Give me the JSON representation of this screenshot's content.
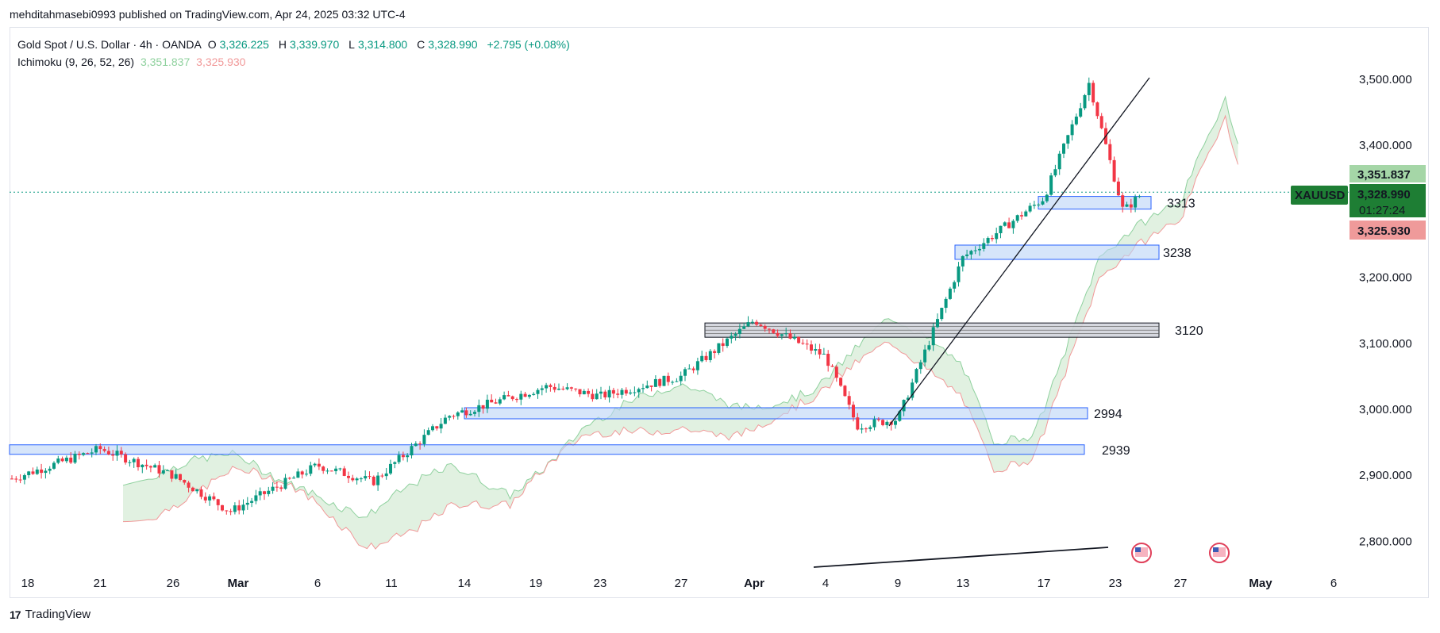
{
  "header": {
    "published_by": "mehditahmasebi0993 published on TradingView.com, Apr 24, 2025 03:32 UTC-4"
  },
  "legend": {
    "symbol_name": "Gold Spot / U.S. Dollar · 4h · OANDA",
    "o_label": "O",
    "o_value": "3,326.225",
    "h_label": "H",
    "h_value": "3,339.970",
    "l_label": "L",
    "l_value": "3,314.800",
    "c_label": "C",
    "c_value": "3,328.990",
    "change": "+2.795 (+0.08%)",
    "indicator_name": "Ichimoku (9, 26, 52, 26)",
    "indicator_val_a": "3,351.837",
    "indicator_val_b": "3,325.930"
  },
  "price_scale": {
    "ticks": [
      "3,500.000",
      "3,400.000",
      "3,200.000",
      "3,100.000",
      "3,000.000",
      "2,900.000",
      "2,800.000"
    ],
    "tick_values": [
      3500,
      3400,
      3200,
      3100,
      3000,
      2900,
      2800
    ],
    "symbol_tag": "XAUUSD",
    "last_price": "3,328.990",
    "countdown": "01:27:24",
    "ichimoku_a_tag": "3,351.837",
    "ichimoku_b_tag": "3,325.930"
  },
  "time_scale": {
    "labels": [
      "18",
      "21",
      "26",
      "Mar",
      "6",
      "11",
      "14",
      "19",
      "23",
      "27",
      "Apr",
      "4",
      "9",
      "13",
      "17",
      "23",
      "27",
      "May",
      "6"
    ],
    "bold": [
      "Mar",
      "Apr",
      "May"
    ]
  },
  "zones": [
    {
      "label": "3313",
      "level": 3313,
      "color": "blue"
    },
    {
      "label": "3238",
      "level": 3238,
      "color": "blue"
    },
    {
      "label": "3120",
      "level": 3120,
      "color": "gray"
    },
    {
      "label": "2994",
      "level": 2994,
      "color": "blue"
    },
    {
      "label": "2939",
      "level": 2939,
      "color": "blue"
    }
  ],
  "footer": {
    "brand": "TradingView",
    "logo_text": "17"
  },
  "colors": {
    "up": "#089981",
    "down": "#f23645",
    "cloud_green": "#c8e6c9",
    "cloud_red": "#f8cccc",
    "zone_blue": "#bbd3f7",
    "zone_blue_border": "#2962ff",
    "zone_gray": "#b0b0b0",
    "tag_green": "#1e7e34",
    "tag_a": "#a5d6a7",
    "tag_b": "#ef9a9a"
  },
  "chart_data": {
    "type": "candlestick",
    "title": "Gold Spot / U.S. Dollar · 4h · OANDA",
    "ylim": [
      2760,
      3520
    ],
    "x_ticks": [
      "18",
      "21",
      "26",
      "Mar",
      "6",
      "11",
      "14",
      "19",
      "23",
      "27",
      "Apr",
      "4",
      "9",
      "13",
      "17",
      "23",
      "27",
      "May",
      "6"
    ],
    "key_path": [
      {
        "t": "18",
        "price": 2895
      },
      {
        "t": "21",
        "price": 2940
      },
      {
        "t": "26",
        "price": 2900
      },
      {
        "t": "Mar",
        "price": 2845
      },
      {
        "t": "6",
        "price": 2915
      },
      {
        "t": "11",
        "price": 2890
      },
      {
        "t": "14",
        "price": 2990
      },
      {
        "t": "19",
        "price": 3035
      },
      {
        "t": "23",
        "price": 3020
      },
      {
        "t": "27",
        "price": 3050
      },
      {
        "t": "Apr",
        "price": 3135
      },
      {
        "t": "4",
        "price": 3080
      },
      {
        "t": "6",
        "price": 2975
      },
      {
        "t": "9",
        "price": 2985
      },
      {
        "t": "13",
        "price": 3230
      },
      {
        "t": "17",
        "price": 3320
      },
      {
        "t": "21",
        "price": 3495
      },
      {
        "t": "23",
        "price": 3300
      },
      {
        "t": "24",
        "price": 3329
      }
    ],
    "ichimoku_last": {
      "span_a": 3351.837,
      "span_b": 3325.93
    },
    "last_close": 3328.99
  }
}
